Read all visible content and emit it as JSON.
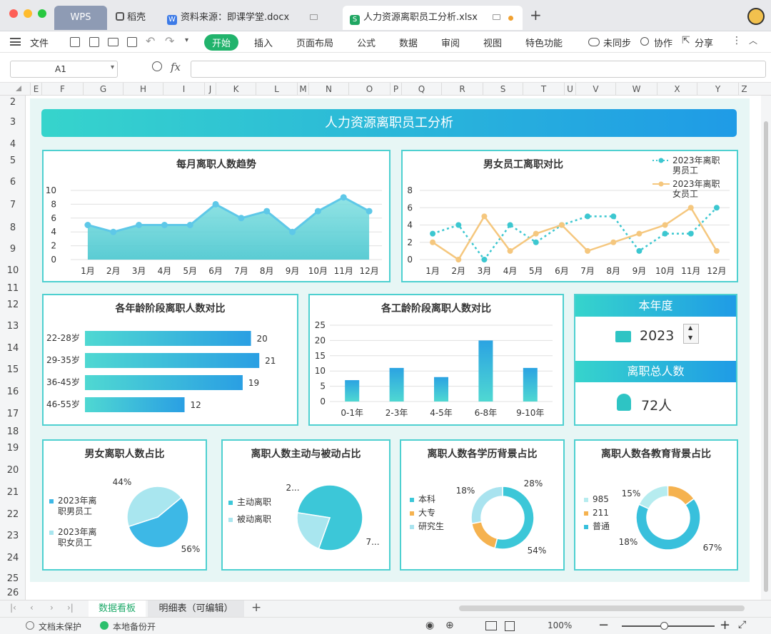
{
  "titlebar": {
    "tabs": [
      {
        "label": "WPS"
      },
      {
        "label": "稻壳"
      },
      {
        "label": "资料来源：即课学堂.docx"
      },
      {
        "label": "人力资源离职员工分析.xlsx"
      }
    ],
    "new_tab": "+"
  },
  "menubar": {
    "items": [
      "文件",
      "开始",
      "插入",
      "页面布局",
      "公式",
      "数据",
      "审阅",
      "视图",
      "特色功能"
    ],
    "sync": "未同步",
    "collab": "协作",
    "share": "分享"
  },
  "formulabar": {
    "cell_ref": "A1",
    "fx": "fx",
    "formula": ""
  },
  "columns": [
    "E",
    "F",
    "G",
    "H",
    "I",
    "J",
    "K",
    "L",
    "M",
    "N",
    "O",
    "P",
    "Q",
    "R",
    "S",
    "T",
    "U",
    "V",
    "W",
    "X",
    "Y",
    "Z"
  ],
  "rows": [
    "2",
    "3",
    "4",
    "5",
    "6",
    "7",
    "8",
    "9",
    "10",
    "11",
    "12",
    "13",
    "14",
    "15",
    "16",
    "17",
    "18",
    "19",
    "20",
    "21",
    "22",
    "23",
    "24",
    "25",
    "26"
  ],
  "dashboard": {
    "title": "人力资源离职员工分析",
    "year_label": "本年度",
    "year_value": "2023",
    "total_label": "离职总人数",
    "total_value": "72人"
  },
  "chart_data": [
    {
      "type": "area",
      "title": "每月离职人数趋势",
      "categories": [
        "1月",
        "2月",
        "3月",
        "4月",
        "5月",
        "6月",
        "7月",
        "8月",
        "9月",
        "10月",
        "11月",
        "12月"
      ],
      "values": [
        5,
        4,
        5,
        5,
        5,
        8,
        6,
        7,
        4,
        7,
        9,
        7
      ],
      "yticks": [
        "0",
        "2",
        "4",
        "6",
        "8",
        "10"
      ],
      "ylim": [
        0,
        10
      ],
      "grid": true
    },
    {
      "type": "line",
      "title": "男女员工离职对比",
      "categories": [
        "1月",
        "2月",
        "3月",
        "4月",
        "5月",
        "6月",
        "7月",
        "8月",
        "9月",
        "10月",
        "11月",
        "12月"
      ],
      "series": [
        {
          "name": "2023年离职男员工",
          "values": [
            3,
            4,
            0,
            4,
            2,
            4,
            5,
            5,
            1,
            3,
            3,
            6
          ],
          "color": "#3cc7d0"
        },
        {
          "name": "2023年离职女员工",
          "values": [
            2,
            0,
            5,
            1,
            3,
            4,
            1,
            2,
            3,
            4,
            6,
            1
          ],
          "color": "#f5c77e"
        }
      ],
      "yticks": [
        "0",
        "2",
        "4",
        "6",
        "8"
      ],
      "ylim": [
        0,
        8
      ],
      "legend": "top-right",
      "grid": true
    },
    {
      "type": "bar",
      "orientation": "horizontal",
      "title": "各年龄阶段离职人数对比",
      "categories": [
        "22-28岁",
        "29-35岁",
        "36-45岁",
        "46-55岁"
      ],
      "values": [
        20,
        21,
        19,
        12
      ]
    },
    {
      "type": "bar",
      "title": "各工龄阶段离职人数对比",
      "categories": [
        "0-1年",
        "2-3年",
        "4-5年",
        "6-8年",
        "9-10年"
      ],
      "values": [
        7,
        11,
        8,
        20,
        11
      ],
      "yticks": [
        "0",
        "5",
        "10",
        "15",
        "20",
        "25"
      ],
      "ylim": [
        0,
        25
      ],
      "grid": true
    },
    {
      "type": "pie",
      "title": "男女离职人数占比",
      "labels": [
        "2023年离职男员工",
        "2023年离职女员工"
      ],
      "values": [
        56,
        44
      ],
      "display": [
        "56%",
        "44%"
      ],
      "colors": [
        "#3db8e6",
        "#a9e6ef"
      ],
      "legend": "left"
    },
    {
      "type": "pie",
      "title": "离职人数主动与被动占比",
      "labels": [
        "主动离职",
        "被动离职"
      ],
      "values": [
        78,
        22
      ],
      "display": [
        "7...",
        "2..."
      ],
      "colors": [
        "#3cc7d8",
        "#a9e6ef"
      ],
      "legend": "left"
    },
    {
      "type": "donut",
      "title": "离职人数各学历背景占比",
      "labels": [
        "本科",
        "大专",
        "研究生"
      ],
      "values": [
        54,
        18,
        28
      ],
      "display": [
        "54%",
        "18%",
        "28%"
      ],
      "colors": [
        "#3cc7d8",
        "#f5b24f",
        "#a9e3ef"
      ],
      "legend": "left"
    },
    {
      "type": "donut",
      "title": "离职人数各教育背景占比",
      "labels": [
        "985",
        "211",
        "普通"
      ],
      "values": [
        18,
        15,
        67
      ],
      "display": [
        "18%",
        "15%",
        "67%"
      ],
      "colors": [
        "#b6ecef",
        "#f5b24f",
        "#38c0dc"
      ],
      "legend": "left"
    }
  ],
  "sheets": {
    "tabs": [
      "数据看板",
      "明细表（可编辑）"
    ],
    "add": "+"
  },
  "statusbar": {
    "doc_status": "文档未保护",
    "backup": "本地备份开",
    "zoom": "100%"
  }
}
